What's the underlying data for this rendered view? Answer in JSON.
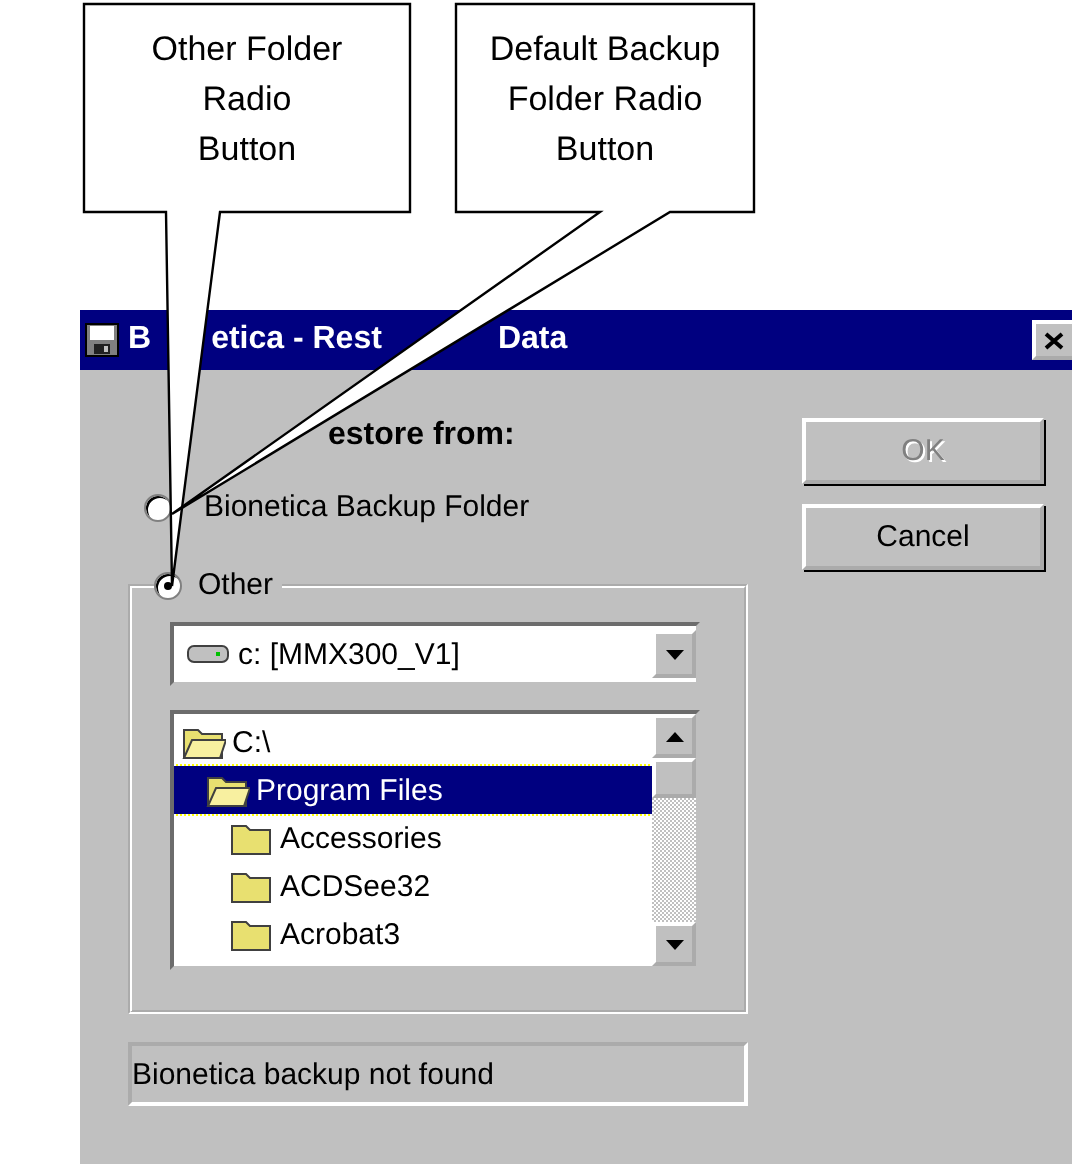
{
  "callouts": [
    {
      "text": "Other Folder\nRadio\nButton"
    },
    {
      "text": "Default Backup\nFolder Radio\nButton"
    }
  ],
  "window": {
    "title_parts": [
      "B",
      "etica - Rest",
      "Data"
    ]
  },
  "heading": "estore from:",
  "radios": [
    {
      "label": "Bionetica Backup Folder",
      "selected": false
    },
    {
      "label": "Other",
      "selected": true
    }
  ],
  "drive": {
    "value": "c: [MMX300_V1]"
  },
  "folders": [
    {
      "name": "C:\\",
      "open": true,
      "selected": false,
      "children": [
        {
          "name": "Program Files",
          "open": true,
          "selected": true,
          "children": [
            {
              "name": "Accessories",
              "open": false,
              "selected": false
            },
            {
              "name": "ACDSee32",
              "open": false,
              "selected": false
            },
            {
              "name": "Acrobat3",
              "open": false,
              "selected": false
            }
          ]
        }
      ]
    }
  ],
  "status": "Bionetica backup not found",
  "buttons": [
    {
      "label": "OK",
      "disabled": true
    },
    {
      "label": "Cancel",
      "disabled": false
    }
  ]
}
